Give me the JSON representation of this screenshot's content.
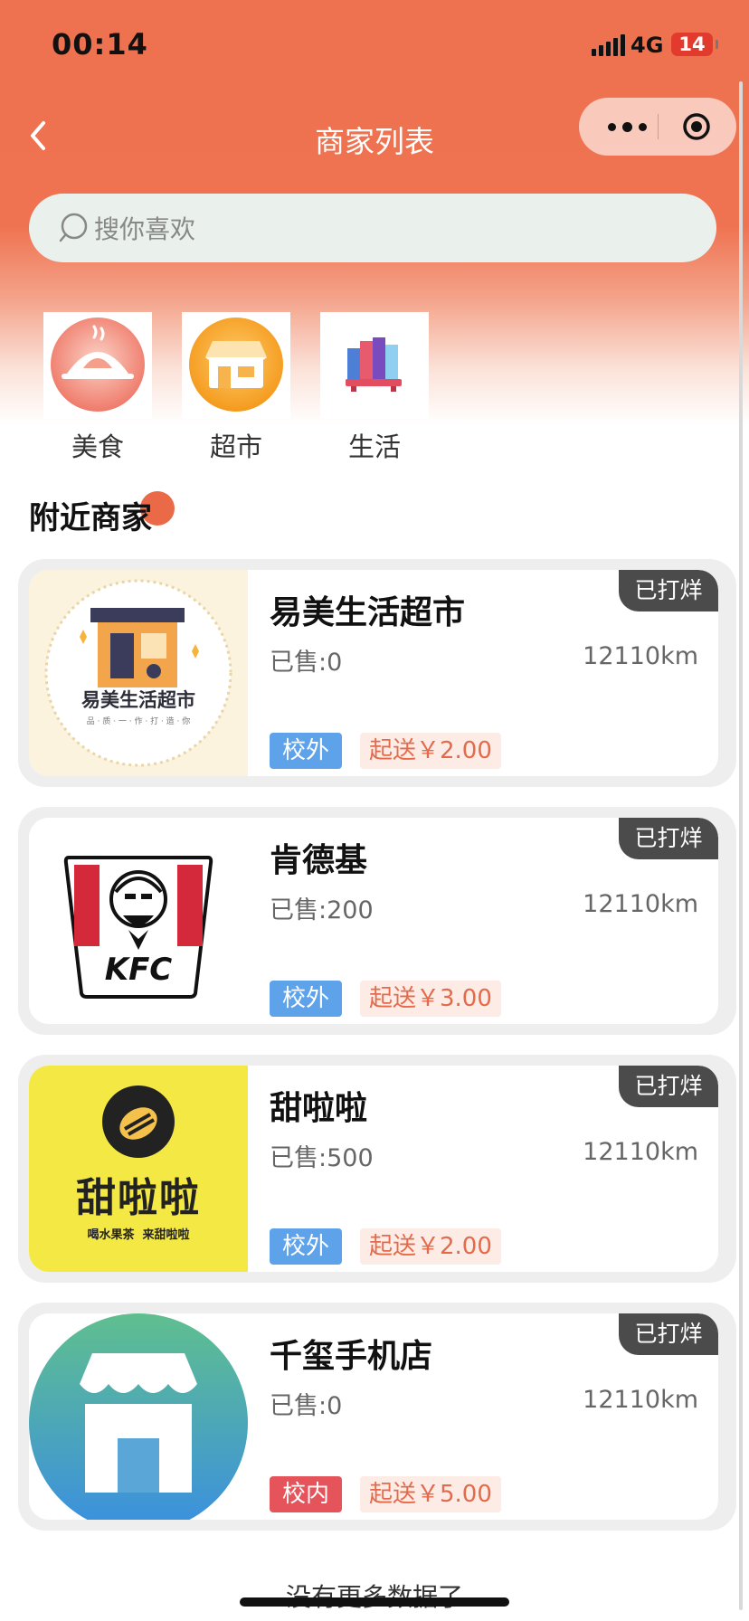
{
  "status": {
    "time": "00:14",
    "network": "4G",
    "battery": "14"
  },
  "nav": {
    "title": "商家列表"
  },
  "search": {
    "placeholder": "搜你喜欢"
  },
  "categories": [
    {
      "label": "美食",
      "icon": "roast-chicken-icon"
    },
    {
      "label": "超市",
      "icon": "storefront-icon"
    },
    {
      "label": "生活",
      "icon": "books-icon"
    }
  ],
  "section": {
    "title": "附近商家"
  },
  "merchants": [
    {
      "name": "易美生活超市",
      "sold": "已售:0",
      "distance": "12110km",
      "tag": "校外",
      "fee": "起送￥2.00",
      "badge": "已打烊",
      "logo_text": "易美生活超市",
      "logo_sub": "品 · 质 · 一 · 作 · 打 · 造 · 你"
    },
    {
      "name": "肯德基",
      "sold": "已售:200",
      "distance": "12110km",
      "tag": "校外",
      "fee": "起送￥3.00",
      "badge": "已打烊",
      "logo_text": "KFC"
    },
    {
      "name": "甜啦啦",
      "sold": "已售:500",
      "distance": "12110km",
      "tag": "校外",
      "fee": "起送￥2.00",
      "badge": "已打烊",
      "logo_text": "甜啦啦",
      "logo_sub": "喝水果茶  来甜啦啦"
    },
    {
      "name": "千玺手机店",
      "sold": "已售:0",
      "distance": "12110km",
      "tag": "校内",
      "fee": "起送￥5.00",
      "badge": "已打烊"
    }
  ],
  "footer": {
    "text": "没有更多数据了"
  },
  "colors": {
    "primary": "#ef7250",
    "tag_outside": "#5ea3ea",
    "tag_inside": "#e5535b",
    "fee_text": "#e36b4c",
    "badge_bg": "#4b4b4b"
  }
}
